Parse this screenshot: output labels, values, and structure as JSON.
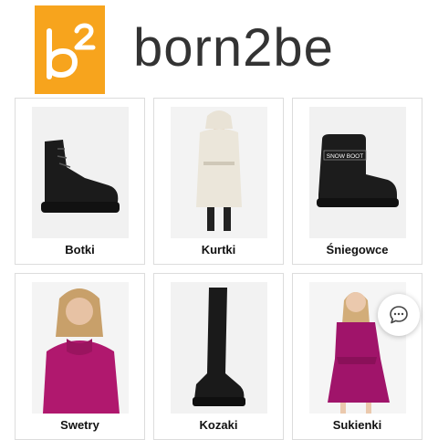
{
  "brand": {
    "logo_mark": "b2",
    "wordmark": "born2be",
    "accent_color": "#f7a41d"
  },
  "categories": [
    {
      "label": "Botki",
      "icon": "ankle-boot-image"
    },
    {
      "label": "Kurtki",
      "icon": "coat-image"
    },
    {
      "label": "Śniegowce",
      "icon": "snow-boot-image",
      "print": "SNOW BOOT"
    },
    {
      "label": "Swetry",
      "icon": "sweater-image"
    },
    {
      "label": "Kozaki",
      "icon": "tall-boot-image"
    },
    {
      "label": "Sukienki",
      "icon": "dress-image"
    }
  ],
  "chat": {
    "icon": "chat-bubble-icon"
  }
}
